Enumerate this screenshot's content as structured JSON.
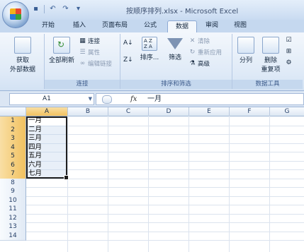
{
  "window": {
    "title": "按顺序排列.xlsx - Microsoft Excel"
  },
  "quick_access": {
    "icons": [
      "save-icon",
      "undo-icon",
      "redo-icon",
      "customize-icon"
    ]
  },
  "tabs": [
    "开始",
    "插入",
    "页面布局",
    "公式",
    "数据",
    "审阅",
    "视图"
  ],
  "active_tab": "数据",
  "ribbon": {
    "get_external": {
      "label_line1": "获取",
      "label_line2": "外部数据"
    },
    "connections": {
      "refresh_all_label": "全部刷新",
      "connections_label": "连接",
      "properties_label": "属性",
      "edit_links_label": "编辑链接",
      "group_label": "连接"
    },
    "sort_filter": {
      "sort_label": "排序...",
      "filter_label": "筛选",
      "clear_label": "清除",
      "reapply_label": "重新应用",
      "advanced_label": "高级",
      "group_label": "排序和筛选"
    },
    "data_tools": {
      "split_label": "分列",
      "remove_dup_line1": "删除",
      "remove_dup_line2": "重复项",
      "group_label": "数据工具"
    }
  },
  "formula_bar": {
    "name_box": "A1",
    "fx": "fx",
    "value": "一月"
  },
  "sheet": {
    "columns": [
      "A",
      "B",
      "C",
      "D",
      "E",
      "F",
      "G"
    ],
    "rows": [
      "1",
      "2",
      "3",
      "4",
      "5",
      "6",
      "7",
      "8",
      "9",
      "10",
      "11",
      "12",
      "13",
      "14"
    ],
    "cells_A": [
      "一月",
      "二月",
      "三月",
      "四月",
      "五月",
      "六月",
      "七月"
    ]
  },
  "colors": {
    "ribbon_bg": "#dfeaf7",
    "selection_header": "#f1c15f",
    "grid_line": "#dbe3ee"
  }
}
